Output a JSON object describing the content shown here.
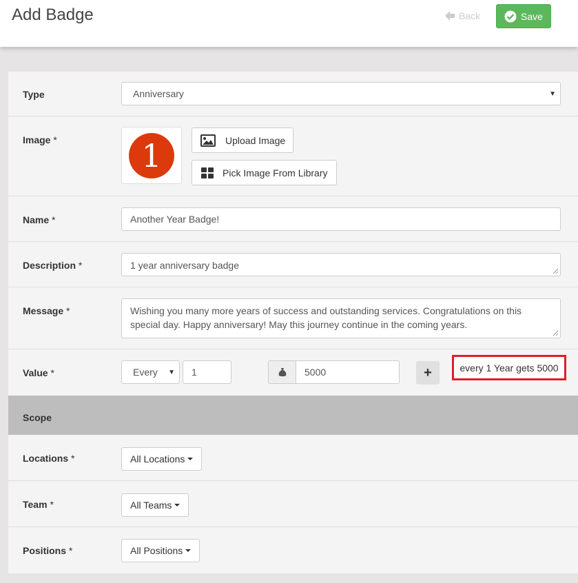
{
  "header": {
    "title": "Add Badge",
    "back_label": "Back",
    "save_label": "Save"
  },
  "form": {
    "type": {
      "label": "Type",
      "value": "Anniversary"
    },
    "image": {
      "label": "Image",
      "required": "*",
      "badge_glyph": "1",
      "upload_label": "Upload Image",
      "library_label": "Pick Image From Library"
    },
    "name": {
      "label": "Name",
      "required": "*",
      "value": "Another Year Badge!"
    },
    "description": {
      "label": "Description",
      "required": "*",
      "value": "1 year anniversary badge"
    },
    "message": {
      "label": "Message",
      "required": "*",
      "value": "Wishing you many more years of success and outstanding services. Congratulations on this special day. Happy anniversary! May this journey continue in the coming years."
    },
    "value": {
      "label": "Value",
      "required": "*",
      "frequency": "Every",
      "count": "1",
      "amount": "5000",
      "summary": "every 1 Year gets 5000"
    }
  },
  "scope": {
    "title": "Scope",
    "locations": {
      "label": "Locations",
      "required": "*",
      "value": "All Locations"
    },
    "team": {
      "label": "Team",
      "required": "*",
      "value": "All Teams"
    },
    "positions": {
      "label": "Positions",
      "required": "*",
      "value": "All Positions"
    }
  },
  "colors": {
    "save_green": "#5cb85c",
    "badge_orange": "#dc3a0c",
    "highlight_red": "#e01e25",
    "scope_gray": "#bdbdbd"
  },
  "icons": [
    "arrow-left-icon",
    "check-circle-icon",
    "image-icon",
    "grid-icon",
    "money-bag-icon",
    "plus-icon",
    "caret-down-icon"
  ]
}
